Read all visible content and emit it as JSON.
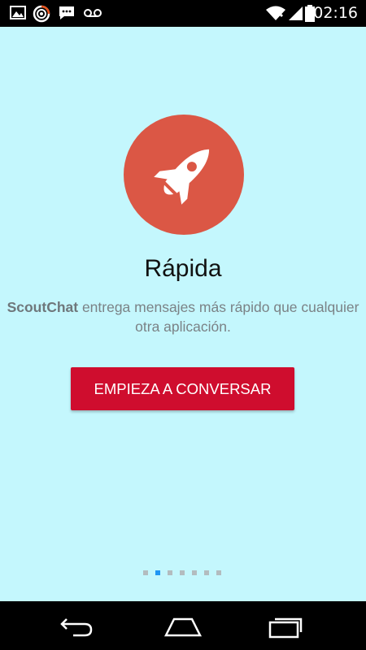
{
  "status_bar": {
    "time": "02:16",
    "left_icons": [
      "image-icon",
      "target-icon",
      "chat-icon",
      "voicemail-icon"
    ],
    "right_icons": [
      "wifi-icon",
      "signal-icon",
      "battery-icon"
    ]
  },
  "onboarding": {
    "icon": "rocket-icon",
    "title": "Rápida",
    "description_brand": "ScoutChat",
    "description_rest": " entrega mensajes más rápido que cualquier otra aplicación.",
    "cta_label": "EMPIEZA A CONVERSAR",
    "page_count": 7,
    "current_page": 2
  },
  "nav_bar": {
    "buttons": [
      "back-icon",
      "home-icon",
      "recents-icon"
    ]
  },
  "colors": {
    "background": "#c4f7fd",
    "hero_circle": "#db5745",
    "cta": "#cf0d2e",
    "active_dot": "#2196f3",
    "inactive_dot": "#b3bcbf"
  }
}
